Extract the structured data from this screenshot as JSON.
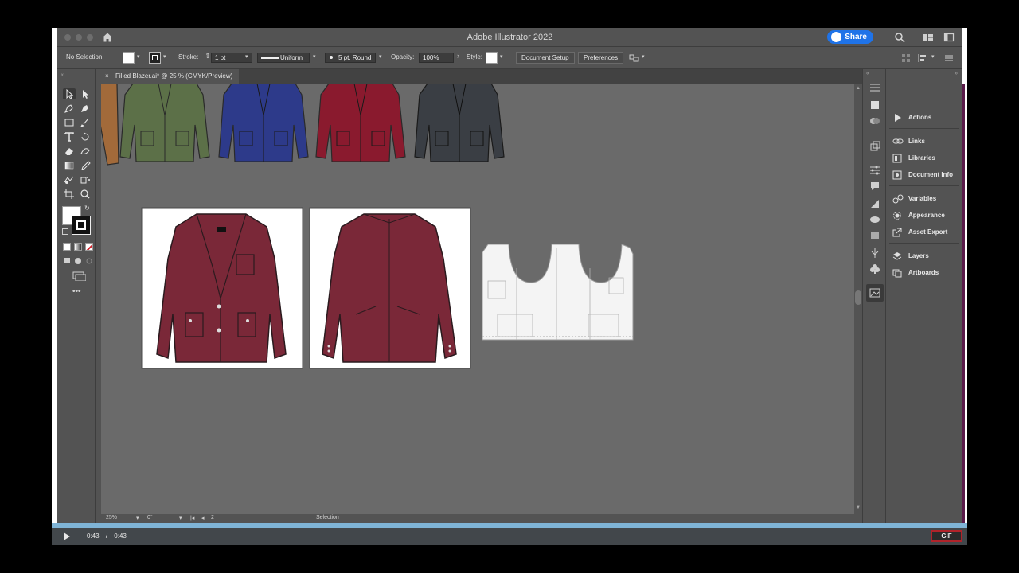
{
  "window": {
    "title": "Adobe Illustrator 2022",
    "share_label": "Share"
  },
  "control_bar": {
    "selection": "No Selection",
    "stroke_label": "Stroke:",
    "stroke_weight": "1 pt",
    "profile": "Uniform",
    "brush": "5 pt. Round",
    "opacity_label": "Opacity:",
    "opacity_value": "100%",
    "style_label": "Style:",
    "document_setup": "Document Setup",
    "preferences": "Preferences"
  },
  "document_tab": {
    "label": "Filled Blazer.ai* @ 25 % (CMYK/Preview)"
  },
  "panels": {
    "items": [
      {
        "label": "Actions",
        "icon": "play-icon"
      },
      {
        "label": "Links",
        "icon": "link-icon"
      },
      {
        "label": "Libraries",
        "icon": "libraries-icon"
      },
      {
        "label": "Document Info",
        "icon": "info-icon"
      },
      {
        "label": "Variables",
        "icon": "variables-icon"
      },
      {
        "label": "Appearance",
        "icon": "appearance-icon"
      },
      {
        "label": "Asset Export",
        "icon": "export-icon"
      },
      {
        "label": "Layers",
        "icon": "layers-icon"
      },
      {
        "label": "Artboards",
        "icon": "artboards-icon"
      }
    ]
  },
  "status_bar": {
    "zoom": "25%",
    "rotation": "0°",
    "artboard_number": "2",
    "tool": "Selection"
  },
  "player": {
    "current_time": "0:43",
    "separator": "/",
    "duration": "0:43",
    "gif_label": "GIF",
    "progress": 1.0
  },
  "colors": {
    "blazer_burgundy": "#7a2838",
    "blazer_green": "#5c7048",
    "blazer_blue": "#2d3a8a",
    "blazer_red": "#8a1a2e",
    "blazer_charcoal": "#3a3e44",
    "blazer_orange": "#a26a3a",
    "share_blue": "#1f73e8",
    "gif_border": "#b0232a"
  }
}
